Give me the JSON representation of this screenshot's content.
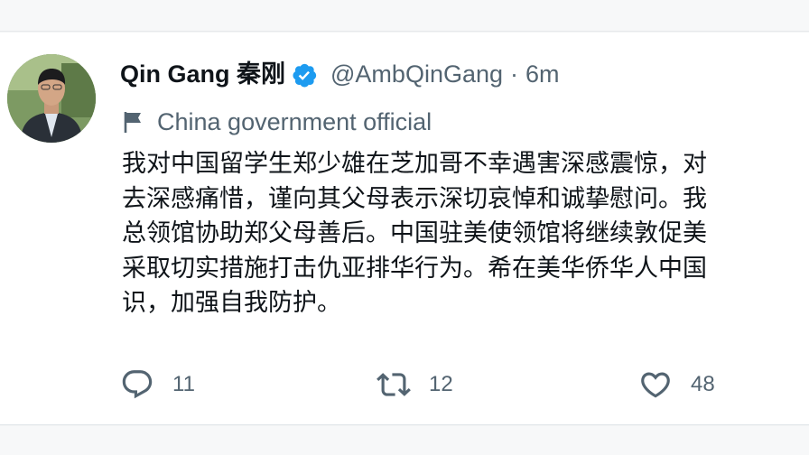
{
  "tweet": {
    "author_name": "Qin Gang 秦刚",
    "handle": "@AmbQinGang",
    "separator": "·",
    "time": "6m",
    "label": "China government official",
    "lines": [
      "我对中国留学生郑少雄在芝加哥不幸遇害深感震惊，对",
      "去深感痛惜，谨向其父母表示深切哀悼和诚挚慰问。我",
      "总领馆协助郑父母善后。中国驻美使领馆将继续敦促美",
      "采取切实措施打击仇亚排华行为。希在美华侨华人中国",
      "识，加强自我防护。"
    ],
    "actions": {
      "reply_count": "11",
      "retweet_count": "12",
      "like_count": "48"
    }
  },
  "colors": {
    "text": "#0f1419",
    "secondary": "#536471",
    "verified_badge": "#1d9bf0"
  },
  "icons": [
    "verified-badge-icon",
    "flag-icon",
    "reply-icon",
    "retweet-icon",
    "like-icon"
  ]
}
